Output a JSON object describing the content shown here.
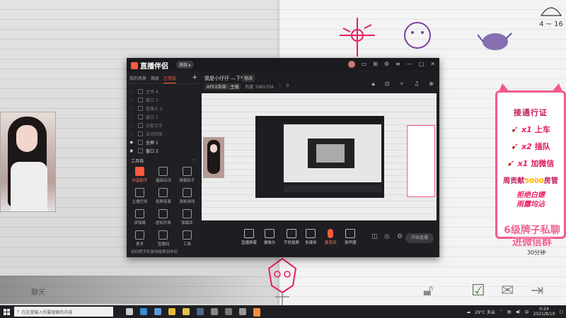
{
  "overlay": {
    "chat_label": "聊天",
    "promo": {
      "title": "接通行证",
      "rows": [
        {
          "mult": "x1",
          "text": "上车"
        },
        {
          "mult": "x2",
          "text": "插队"
        },
        {
          "mult": "x1",
          "text": "加微信"
        }
      ],
      "contrib_pre": "周贡献",
      "contrib_num": "5000",
      "contrib_post": "房管",
      "slogan_1": "拒绝白嫖",
      "slogan_2": "雨露均沾"
    },
    "banner": "6级牌子私聊进微信群",
    "countdown": "30分钟",
    "corner_text": "4 ~ 16",
    "colors": {
      "accent": "#ff5a3c",
      "pink": "#e91e63"
    }
  },
  "app": {
    "logo_text": "直播伴侣",
    "version": "旗舰 ▸",
    "left_tabs": [
      "我的场景",
      "图层",
      "已添加"
    ],
    "scenes": [
      {
        "label": "主场 4",
        "visible": false
      },
      {
        "label": "窗口 3",
        "visible": false
      },
      {
        "label": "摄像头 2",
        "visible": false
      },
      {
        "label": "窗口 1",
        "visible": false
      },
      {
        "label": "白板文字",
        "visible": false
      },
      {
        "label": "自动回复",
        "visible": false
      },
      {
        "label": "全屏 1",
        "visible": true
      },
      {
        "label": "窗口 2",
        "visible": true
      }
    ],
    "tools_header": "工具箱",
    "tools": [
      {
        "label": "抖音助手",
        "hot": true
      },
      {
        "label": "福袋玩法",
        "hot": false
      },
      {
        "label": "弹幕助手",
        "hot": false
      },
      {
        "label": "主播任务",
        "hot": false
      },
      {
        "label": "投屏连麦",
        "hot": false
      },
      {
        "label": "录制游戏",
        "hot": false
      },
      {
        "label": "读弹幕",
        "hot": false
      },
      {
        "label": "虚拟形象",
        "hot": false
      },
      {
        "label": "弹幕库",
        "hot": false
      },
      {
        "label": "更多",
        "hot": false
      },
      {
        "label": "直播间",
        "hot": false
      },
      {
        "label": "工具",
        "hot": false
      }
    ],
    "tip": "如何把手机游戏投屏到伴侣",
    "room": {
      "name": "我是小仔仔 —下♥",
      "mod_label": "修改",
      "category": "APEX英雄 · 主播",
      "hot": "热度 1965356",
      "likes": "0"
    },
    "bottom_bar": [
      {
        "label": "直播屏幕",
        "kind": "normal"
      },
      {
        "label": "摄像头",
        "kind": "normal"
      },
      {
        "label": "手机投屏",
        "kind": "normal"
      },
      {
        "label": "多媒体",
        "kind": "normal"
      },
      {
        "label": "麦克风",
        "kind": "mic"
      },
      {
        "label": "扬声器",
        "kind": "normal"
      }
    ],
    "go_live": "开始直播"
  },
  "taskbar": {
    "search_placeholder": "在这里输入你要搜索的内容",
    "weather": "29°C 多云",
    "time": "0:24",
    "date": "2021/8/19",
    "ime": "中",
    "apps": [
      {
        "name": "task-view",
        "color": "#cccccc"
      },
      {
        "name": "edge",
        "color": "#2f8fd6"
      },
      {
        "name": "store",
        "color": "#5a9bd5"
      },
      {
        "name": "chrome",
        "color": "#e8b83a"
      },
      {
        "name": "file-explorer",
        "color": "#e5c04a"
      },
      {
        "name": "steam",
        "color": "#4a6a8c"
      },
      {
        "name": "app-a",
        "color": "#888888"
      },
      {
        "name": "app-b",
        "color": "#777777"
      },
      {
        "name": "app-c",
        "color": "#999999"
      },
      {
        "name": "live-companion",
        "color": "#ff8c3c"
      }
    ]
  }
}
